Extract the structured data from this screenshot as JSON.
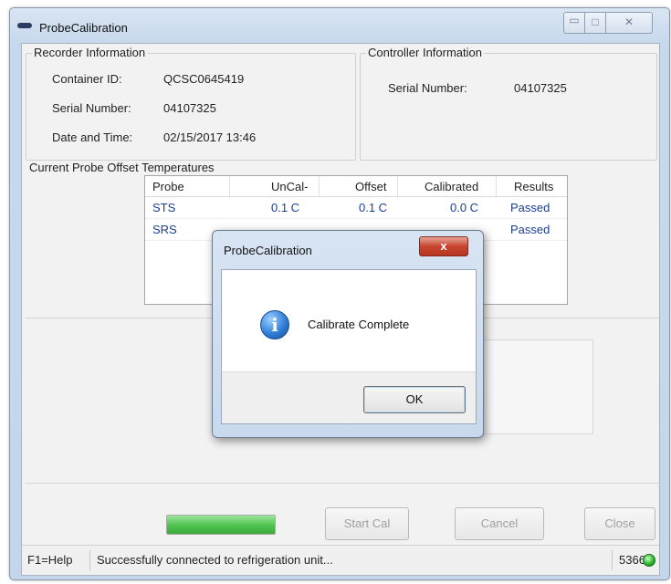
{
  "window": {
    "title": "ProbeCalibration",
    "controls": {
      "minimize": "▭",
      "maximize": "□",
      "close": "✕"
    }
  },
  "recorder": {
    "group_label": "Recorder Information",
    "container_id_label": "Container ID:",
    "container_id_value": "QCSC0645419",
    "serial_label": "Serial Number:",
    "serial_value": "04107325",
    "datetime_label": "Date and Time:",
    "datetime_value": "02/15/2017 13:46"
  },
  "controller": {
    "group_label": "Controller Information",
    "serial_label": "Serial Number:",
    "serial_value": "04107325"
  },
  "probe_offsets": {
    "group_label": "Current Probe Offset Temperatures",
    "columns": [
      "Probe",
      "UnCal-",
      "Offset",
      "Calibrated",
      "Results"
    ],
    "rows": [
      {
        "probe": "STS",
        "uncal": "0.1 C",
        "offset": "0.1 C",
        "calibrated": "0.0 C",
        "result": "Passed"
      },
      {
        "probe": "SRS",
        "uncal": "",
        "offset": "",
        "calibrated": "",
        "result": "Passed"
      }
    ]
  },
  "progress": {
    "fraction": 1.0,
    "color": "#4fc34f"
  },
  "buttons": {
    "start_cal": "Start Cal",
    "cancel": "Cancel",
    "close": "Close"
  },
  "statusbar": {
    "help": "F1=Help",
    "message": "Successfully connected to refrigeration unit...",
    "port": "5366",
    "led_color": "#21b321"
  },
  "dialog": {
    "title": "ProbeCalibration",
    "close_glyph": "x",
    "icon": "info-icon",
    "icon_glyph": "i",
    "message": "Calibrate Complete",
    "ok_label": "OK"
  }
}
